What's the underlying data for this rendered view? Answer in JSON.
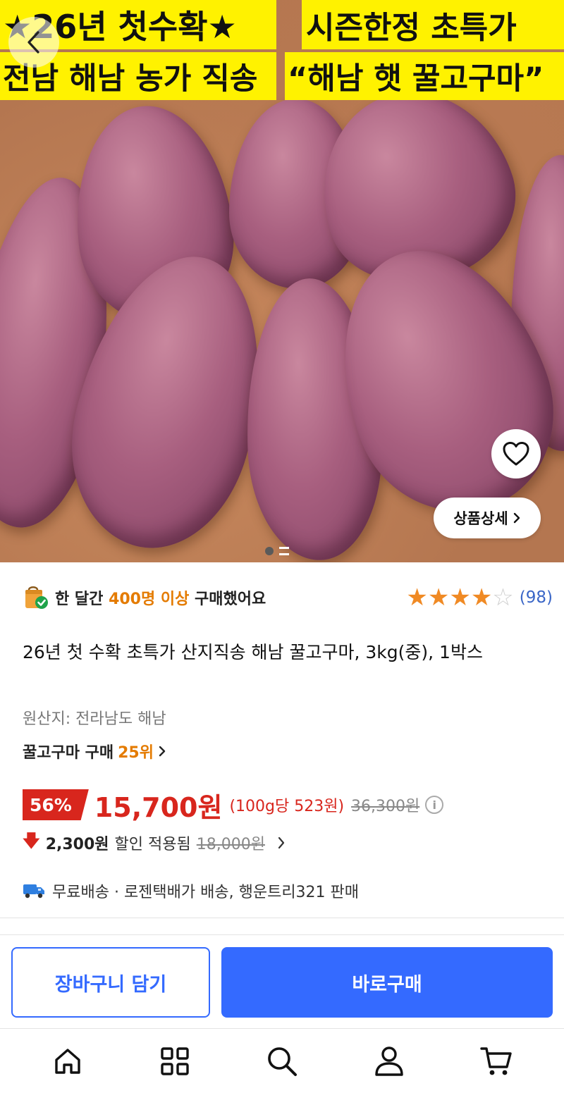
{
  "hero": {
    "banner_1": "★26년 첫수확★",
    "banner_2": "시즌한정 초특가",
    "banner_3": "전남 해남 농가 직송",
    "banner_4": "“해남 햇 꿀고구마”",
    "detail_button_label": "상품상세"
  },
  "social_proof": {
    "prefix": "한 달간",
    "highlight": "400명 이상",
    "suffix": "구매했어요"
  },
  "rating": {
    "stars_filled": 4,
    "stars_total": 5,
    "review_count": "(98)"
  },
  "product": {
    "title": "26년 첫 수확 초특가 산지직송 해남 꿀고구마, 3kg(중), 1박스",
    "origin": "원산지: 전라남도 해남",
    "ranking_label": "꿀고구마 구매",
    "ranking_value": "25위"
  },
  "price": {
    "discount_rate": "56%",
    "sale_price": "15,700원",
    "unit_price": "(100g당 523원)",
    "original_price": "36,300원",
    "coupon_amount": "2,300원",
    "coupon_label": "할인 적용됨",
    "coupon_prev_price": "18,000원"
  },
  "shipping": {
    "text": "무료배송 · 로젠택배가 배송, 행운트리321 판매"
  },
  "actions": {
    "cart_label": "장바구니 담기",
    "buy_label": "바로구매"
  },
  "colors": {
    "accent_blue": "#346aff",
    "sale_red": "#d8261d",
    "highlight_orange": "#e47b00",
    "banner_yellow": "#fff200"
  },
  "tabs": [
    {
      "icon": "home-icon"
    },
    {
      "icon": "category-icon"
    },
    {
      "icon": "search-icon"
    },
    {
      "icon": "user-icon"
    },
    {
      "icon": "cart-icon"
    }
  ]
}
